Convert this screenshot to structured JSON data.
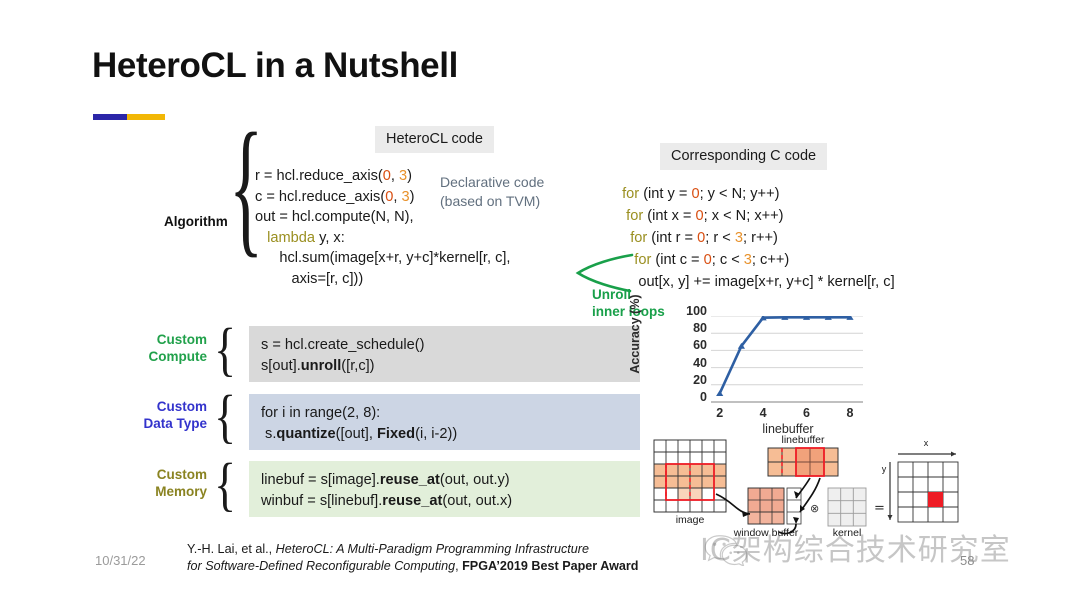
{
  "slide": {
    "title": "HeteroCL in a Nutshell",
    "accent_colors": {
      "left": "#2b26a8",
      "right": "#f2b705"
    }
  },
  "chips": {
    "hcl_code": "HeteroCL code",
    "c_code": "Corresponding C code"
  },
  "algorithm": {
    "label": "Algorithm",
    "lines": [
      [
        {
          "t": "r = hcl.reduce_axis(",
          "c": "plain"
        },
        {
          "t": "0",
          "c": "num-a"
        },
        {
          "t": ", ",
          "c": "plain"
        },
        {
          "t": "3",
          "c": "num-b"
        },
        {
          "t": ")",
          "c": "plain"
        }
      ],
      [
        {
          "t": "c = hcl.reduce_axis(",
          "c": "plain"
        },
        {
          "t": "0",
          "c": "num-a"
        },
        {
          "t": ", ",
          "c": "plain"
        },
        {
          "t": "3",
          "c": "num-b"
        },
        {
          "t": ")",
          "c": "plain"
        }
      ],
      [
        {
          "t": "out = hcl.compute(N, N),",
          "c": "plain"
        }
      ],
      [
        {
          "t": "   ",
          "c": "plain"
        },
        {
          "t": "lambda",
          "c": "kw-lambda"
        },
        {
          "t": " y, x:",
          "c": "plain"
        }
      ],
      [
        {
          "t": "      hcl.sum(image[x+r, y+c]*kernel[r, c],",
          "c": "plain"
        }
      ],
      [
        {
          "t": "         axis=[r, c]))",
          "c": "plain"
        }
      ]
    ],
    "note": "Declarative code\n(based on TVM)",
    "note_color": "#62707f"
  },
  "c_code": {
    "lines": [
      [
        {
          "t": "  ",
          "c": "plain"
        },
        {
          "t": "for",
          "c": "kw-for"
        },
        {
          "t": " (int y = ",
          "c": "plain"
        },
        {
          "t": "0",
          "c": "num-a"
        },
        {
          "t": "; y < N; y++)",
          "c": "plain"
        }
      ],
      [
        {
          "t": "   ",
          "c": "plain"
        },
        {
          "t": "for",
          "c": "kw-for"
        },
        {
          "t": " (int x = ",
          "c": "plain"
        },
        {
          "t": "0",
          "c": "num-a"
        },
        {
          "t": "; x < N; x++)",
          "c": "plain"
        }
      ],
      [
        {
          "t": "    ",
          "c": "plain"
        },
        {
          "t": "for",
          "c": "kw-for"
        },
        {
          "t": " (int r = ",
          "c": "plain"
        },
        {
          "t": "0",
          "c": "num-a"
        },
        {
          "t": "; r < ",
          "c": "plain"
        },
        {
          "t": "3",
          "c": "num-b"
        },
        {
          "t": "; r++)",
          "c": "plain"
        }
      ],
      [
        {
          "t": "     ",
          "c": "plain"
        },
        {
          "t": "for",
          "c": "kw-for"
        },
        {
          "t": " (int c = ",
          "c": "plain"
        },
        {
          "t": "0",
          "c": "num-a"
        },
        {
          "t": "; c < ",
          "c": "plain"
        },
        {
          "t": "3",
          "c": "num-b"
        },
        {
          "t": "; c++)",
          "c": "plain"
        }
      ],
      [
        {
          "t": "      out[x, y] += image[x+r, y+c] * kernel[r, c]",
          "c": "plain"
        }
      ]
    ],
    "annotation": "Unroll\ninner loops",
    "annotation_color": "#19a04a"
  },
  "customizations": [
    {
      "label": "Custom\nCompute",
      "label_color": "#21a14b",
      "box_color": "#d9d9d9",
      "lines": [
        [
          {
            "t": "s = hcl.create_schedule()",
            "c": "plain"
          }
        ],
        [
          {
            "t": "s[out].",
            "c": "plain"
          },
          {
            "t": "unroll",
            "c": "bold"
          },
          {
            "t": "([r,c])",
            "c": "plain"
          }
        ]
      ]
    },
    {
      "label": "Custom\nData Type",
      "label_color": "#3333cc",
      "box_color": "#ccd5e4",
      "lines": [
        [
          {
            "t": "for i in range(2, 8):",
            "c": "plain"
          }
        ],
        [
          {
            "t": " s.",
            "c": "plain"
          },
          {
            "t": "quantize",
            "c": "bold"
          },
          {
            "t": "([out], ",
            "c": "plain"
          },
          {
            "t": "Fixed",
            "c": "bold"
          },
          {
            "t": "(i, i-2))",
            "c": "plain"
          }
        ]
      ]
    },
    {
      "label": "Custom\nMemory",
      "label_color": "#8a8321",
      "box_color": "#e2efda",
      "lines": [
        [
          {
            "t": "linebuf = s[image].",
            "c": "plain"
          },
          {
            "t": "reuse_at",
            "c": "bold"
          },
          {
            "t": "(out, out.y)",
            "c": "plain"
          }
        ],
        [
          {
            "t": "winbuf = s[linebuf].",
            "c": "plain"
          },
          {
            "t": "reuse_at",
            "c": "bold"
          },
          {
            "t": "(out, out.x)",
            "c": "plain"
          }
        ]
      ]
    }
  ],
  "chart_data": {
    "type": "line",
    "title": "",
    "xlabel": "linebuffer",
    "ylabel": "Accuracy (%)",
    "x": [
      2,
      3,
      4,
      5,
      6,
      7,
      8
    ],
    "values": [
      10,
      65,
      98,
      98.5,
      98.5,
      98.5,
      98.5
    ],
    "xticks": [
      2,
      4,
      6,
      8
    ],
    "yticks": [
      0,
      20,
      40,
      60,
      80,
      100
    ],
    "xlim": [
      1.6,
      8.6
    ],
    "ylim": [
      0,
      100
    ],
    "grid": true,
    "legend": "none",
    "series_color": "#2e5fa3",
    "marker": "triangle"
  },
  "diagram": {
    "labels": {
      "image": "image",
      "linebuffer": "linebuffer",
      "window_buffer": "window buffer",
      "kernel": "kernel",
      "x_axis": "x",
      "y_axis": "y",
      "conv_op": "⊗",
      "equals": "="
    }
  },
  "footer": {
    "date": "10/31/22",
    "citation_line1_plain": "Y.-H. Lai, et al., ",
    "citation_line1_italic": "HeteroCL: A Multi-Paradigm Programming Infrastructure",
    "citation_line2_italic": "for Software-Defined Reconfigurable Computing",
    "citation_line2_sep": ", ",
    "citation_line2_bold": "FPGA’2019 Best Paper Award",
    "page_number": "58"
  },
  "watermark": {
    "text": "IC架构综合技术研究室",
    "icon": "wechat-logo"
  }
}
